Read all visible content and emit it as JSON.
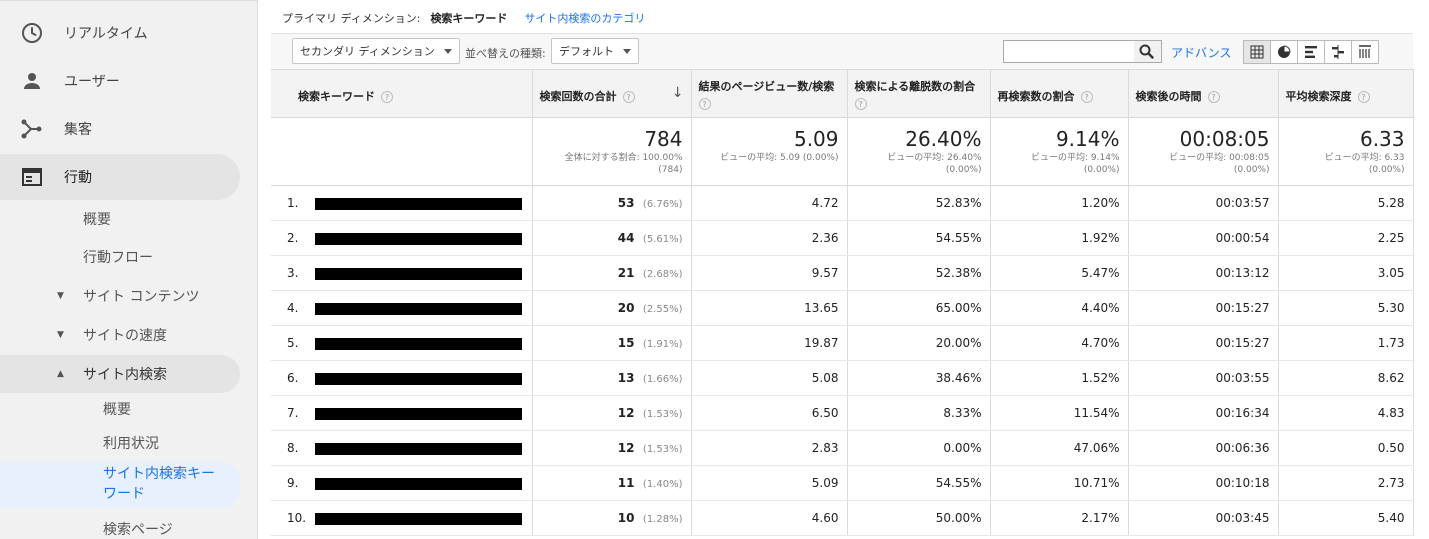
{
  "sidebar": {
    "top_items": [
      {
        "label": "リアルタイム",
        "icon": "clock-icon"
      },
      {
        "label": "ユーザー",
        "icon": "person-icon"
      },
      {
        "label": "集客",
        "icon": "acquisition-icon"
      },
      {
        "label": "行動",
        "icon": "behavior-icon"
      }
    ],
    "behavior_sub": {
      "overview": "概要",
      "flow": "行動フロー",
      "site_content": "サイト コンテンツ",
      "site_speed": "サイトの速度",
      "site_search": "サイト内検索"
    },
    "search_sub": {
      "overview": "概要",
      "usage": "利用状況",
      "terms_line1": "サイト内検索キー",
      "terms_line2": "ワード",
      "pages": "検索ページ"
    }
  },
  "dimension_bar": {
    "label": "プライマリ ディメンション:",
    "current": "検索キーワード",
    "alternative": "サイト内検索のカテゴリ"
  },
  "toolbar": {
    "secondary_dimension": "セカンダリ ディメンション",
    "sort_type_label": "並べ替えの種類:",
    "sort_type_value": "デフォルト",
    "search_value": "",
    "advanced": "アドバンス"
  },
  "table": {
    "headers": [
      "検索キーワード",
      "検索回数の合計",
      "結果のページビュー数/検索",
      "検索による離脱数の割合",
      "再検索数の割合",
      "検索後の時間",
      "平均検索深度"
    ],
    "help_mark": "?",
    "sort_arrow": "↓",
    "totals": [
      {
        "value": "784",
        "sub1": "全体に対する割合: 100.00%",
        "sub2": "(784)"
      },
      {
        "value": "5.09",
        "sub1": "ビューの平均: 5.09 (0.00%)",
        "sub2": ""
      },
      {
        "value": "26.40%",
        "sub1": "ビューの平均: 26.40%",
        "sub2": "(0.00%)"
      },
      {
        "value": "9.14%",
        "sub1": "ビューの平均: 9.14%",
        "sub2": "(0.00%)"
      },
      {
        "value": "00:08:05",
        "sub1": "ビューの平均: 00:08:05",
        "sub2": "(0.00%)"
      },
      {
        "value": "6.33",
        "sub1": "ビューの平均: 6.33",
        "sub2": "(0.00%)"
      }
    ],
    "rows": [
      {
        "n": "1.",
        "searches": "53",
        "share": "(6.76%)",
        "pv": "4.72",
        "exit": "52.83%",
        "refine": "1.20%",
        "time": "00:03:57",
        "depth": "5.28"
      },
      {
        "n": "2.",
        "searches": "44",
        "share": "(5.61%)",
        "pv": "2.36",
        "exit": "54.55%",
        "refine": "1.92%",
        "time": "00:00:54",
        "depth": "2.25"
      },
      {
        "n": "3.",
        "searches": "21",
        "share": "(2.68%)",
        "pv": "9.57",
        "exit": "52.38%",
        "refine": "5.47%",
        "time": "00:13:12",
        "depth": "3.05"
      },
      {
        "n": "4.",
        "searches": "20",
        "share": "(2.55%)",
        "pv": "13.65",
        "exit": "65.00%",
        "refine": "4.40%",
        "time": "00:15:27",
        "depth": "5.30"
      },
      {
        "n": "5.",
        "searches": "15",
        "share": "(1.91%)",
        "pv": "19.87",
        "exit": "20.00%",
        "refine": "4.70%",
        "time": "00:15:27",
        "depth": "1.73"
      },
      {
        "n": "6.",
        "searches": "13",
        "share": "(1.66%)",
        "pv": "5.08",
        "exit": "38.46%",
        "refine": "1.52%",
        "time": "00:03:55",
        "depth": "8.62"
      },
      {
        "n": "7.",
        "searches": "12",
        "share": "(1.53%)",
        "pv": "6.50",
        "exit": "8.33%",
        "refine": "11.54%",
        "time": "00:16:34",
        "depth": "4.83"
      },
      {
        "n": "8.",
        "searches": "12",
        "share": "(1.53%)",
        "pv": "2.83",
        "exit": "0.00%",
        "refine": "47.06%",
        "time": "00:06:36",
        "depth": "0.50"
      },
      {
        "n": "9.",
        "searches": "11",
        "share": "(1.40%)",
        "pv": "5.09",
        "exit": "54.55%",
        "refine": "10.71%",
        "time": "00:10:18",
        "depth": "2.73"
      },
      {
        "n": "10.",
        "searches": "10",
        "share": "(1.28%)",
        "pv": "4.60",
        "exit": "50.00%",
        "refine": "2.17%",
        "time": "00:03:45",
        "depth": "5.40"
      }
    ]
  },
  "colors": {
    "accent": "#1a73e8",
    "sidebar_bg": "#f1f1f1",
    "active_bg": "#e4e4e4",
    "selected_bg": "#e8f0fe"
  }
}
